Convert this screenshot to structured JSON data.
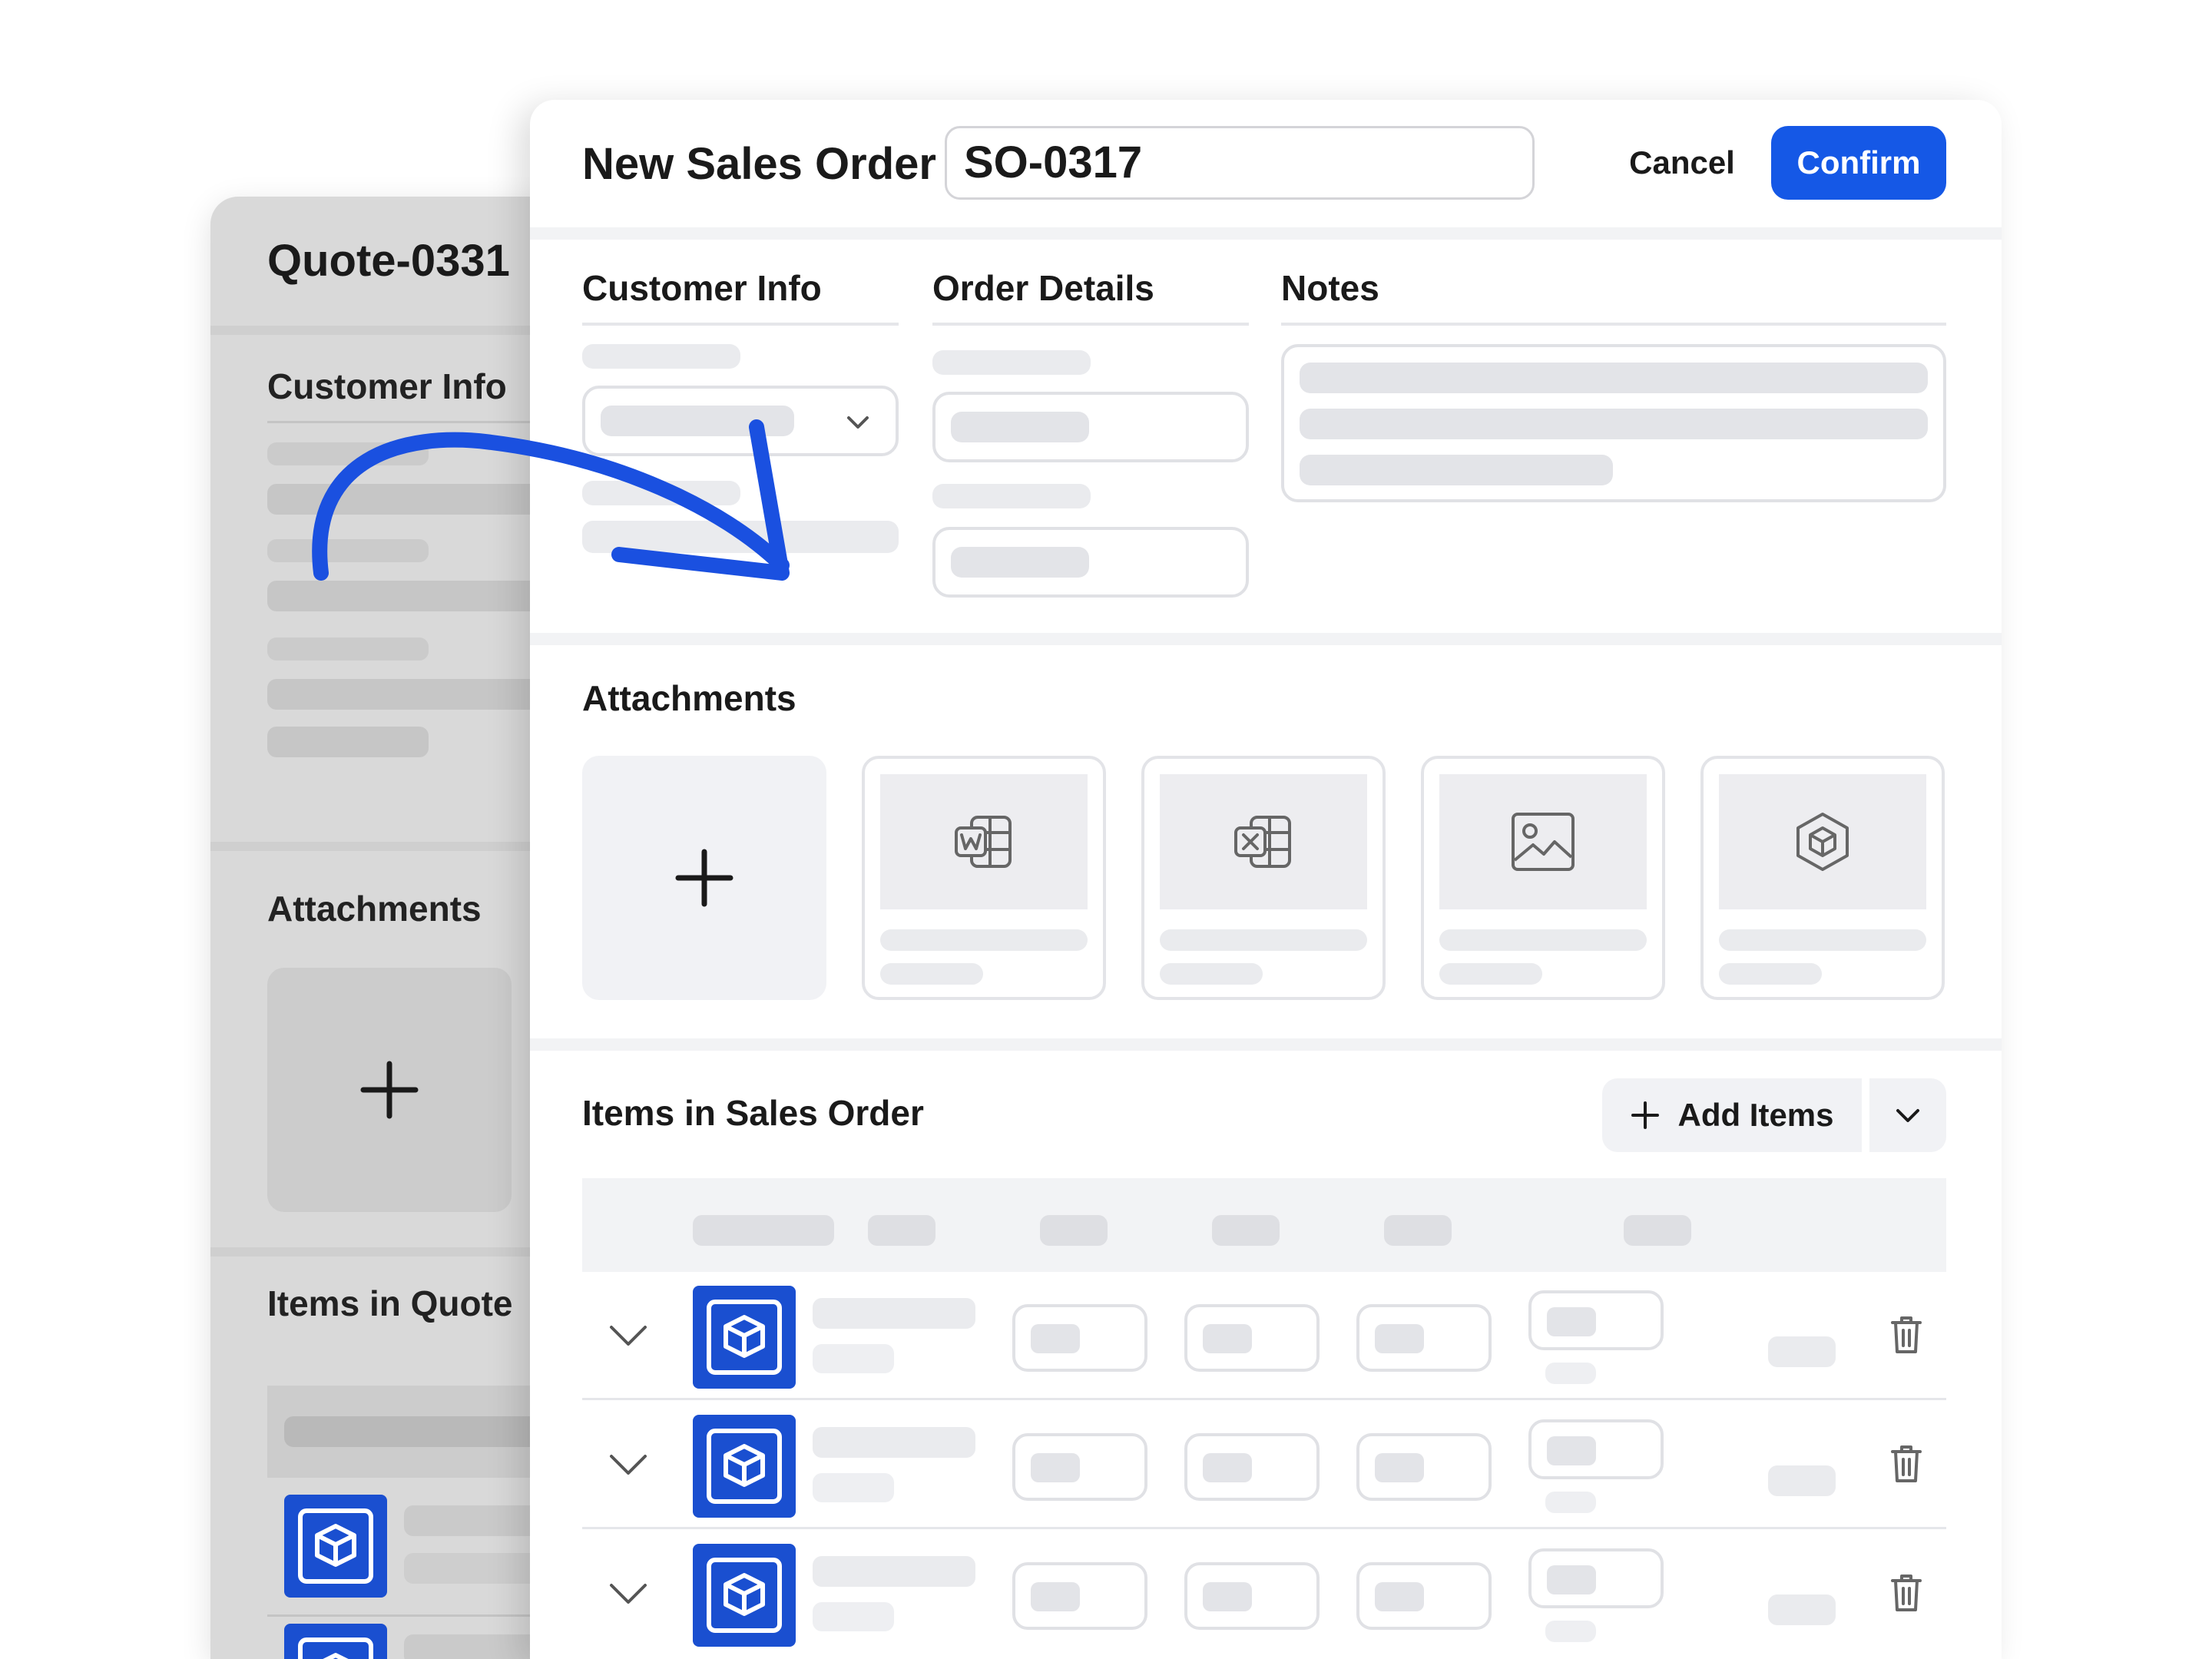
{
  "colors": {
    "accent": "#1558e6",
    "thumb_blue": "#1a4fd0",
    "arrow": "#1a50e0"
  },
  "quote": {
    "title": "Quote-0331",
    "customer_info": "Customer Info",
    "attachments": "Attachments",
    "items": "Items in Quote"
  },
  "header": {
    "title": "New Sales Order",
    "order_number": "SO-0317",
    "cancel_label": "Cancel",
    "confirm_label": "Confirm"
  },
  "sections": {
    "customer_info": "Customer Info",
    "order_details": "Order Details",
    "notes": "Notes"
  },
  "attachments": {
    "title": "Attachments",
    "files": [
      {
        "icon": "word-document-icon"
      },
      {
        "icon": "excel-spreadsheet-icon"
      },
      {
        "icon": "image-file-icon"
      },
      {
        "icon": "3d-model-icon"
      }
    ]
  },
  "items": {
    "title": "Items in Sales Order",
    "add_label": "Add Items",
    "row_count": 3
  }
}
